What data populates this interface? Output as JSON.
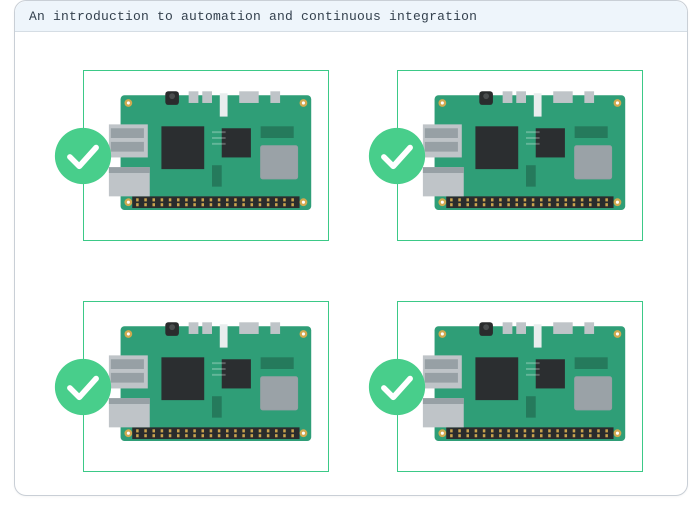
{
  "window": {
    "title": "An introduction to automation and continuous integration"
  },
  "colors": {
    "accent": "#48CE8B",
    "frame_border": "#3bc987",
    "pcb": "#2F9E77",
    "pcb_dark": "#257A5C",
    "port_gray": "#BFC4C8",
    "port_dark": "#97A0A5",
    "chip_black": "#2B2E30",
    "chip_gray": "#9AA2A7",
    "header_black": "#2A2C2D",
    "pin_gold": "#C9A34E",
    "hole_gold": "#D1A94F"
  },
  "cards": [
    {
      "status": "success",
      "device": "raspberry-pi",
      "badge_icon": "check-icon"
    },
    {
      "status": "success",
      "device": "raspberry-pi",
      "badge_icon": "check-icon"
    },
    {
      "status": "success",
      "device": "raspberry-pi",
      "badge_icon": "check-icon"
    },
    {
      "status": "success",
      "device": "raspberry-pi",
      "badge_icon": "check-icon"
    }
  ]
}
